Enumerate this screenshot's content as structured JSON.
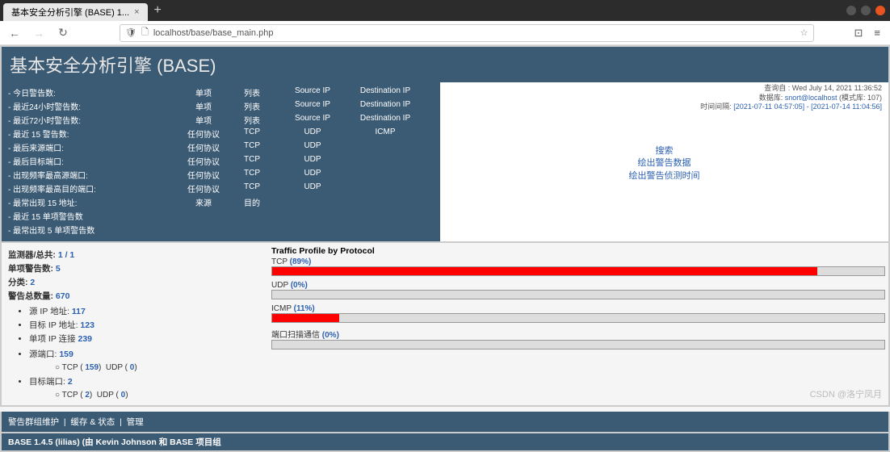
{
  "browser": {
    "tab_title": "基本安全分析引擎 (BASE) 1...",
    "url": "localhost/base/base_main.php"
  },
  "header": {
    "title": "基本安全分析引擎 (BASE)"
  },
  "left": {
    "rows1": [
      {
        "label": "- 今日警告数:",
        "c": [
          "单项",
          "列表",
          "Source IP",
          "Destination IP"
        ]
      },
      {
        "label": "- 最近24小时警告数:",
        "c": [
          "单项",
          "列表",
          "Source IP",
          "Destination IP"
        ]
      },
      {
        "label": "- 最近72小时警告数:",
        "c": [
          "单项",
          "列表",
          "Source IP",
          "Destination IP"
        ]
      },
      {
        "label": "- 最近 15 警告数:",
        "c": [
          "任何协议",
          "TCP",
          "UDP",
          "ICMP"
        ]
      },
      {
        "label": "- 最后来源端口:",
        "c": [
          "任何协议",
          "TCP",
          "UDP",
          ""
        ]
      },
      {
        "label": "- 最后目标端口:",
        "c": [
          "任何协议",
          "TCP",
          "UDP",
          ""
        ]
      },
      {
        "label": "- 出现频率最高源端口:",
        "c": [
          "任何协议",
          "TCP",
          "UDP",
          ""
        ]
      },
      {
        "label": "- 出现频率最高目的端口:",
        "c": [
          "任何协议",
          "TCP",
          "UDP",
          ""
        ]
      },
      {
        "label": "- 最常出现 15 地址:",
        "c": [
          "来源",
          "目的",
          "",
          ""
        ]
      },
      {
        "label": "- 最近 15 单项警告数",
        "c": [
          "",
          "",
          "",
          ""
        ]
      },
      {
        "label": "- 最常出现 5 单项警告数",
        "c": [
          "",
          "",
          "",
          ""
        ]
      }
    ]
  },
  "meta": {
    "queried": "查询自 : Wed July 14, 2021 11:36:52",
    "db_label": "数据库:",
    "db_val": "snort@localhost",
    "db_schema": "(模式库: 107)",
    "time_label": "时间间隔:",
    "time_val": "[2021-07-11 04:57:05] - [2021-07-14 11:04:56]"
  },
  "rlinks": [
    "搜索",
    "绘出警告数据",
    "绘出警告侦测时间"
  ],
  "stats": {
    "l1": {
      "a": "监测器/总共:",
      "b": "1 / 1"
    },
    "l2": {
      "a": "单项警告数:",
      "b": "5"
    },
    "l3": {
      "a": "分类:",
      "b": "2"
    },
    "l4": {
      "a": "警告总数量:",
      "b": "670"
    },
    "li1": {
      "a": "源 IP 地址:",
      "b": "117"
    },
    "li2": {
      "a": "目标 IP 地址:",
      "b": "123"
    },
    "li3": {
      "a": "单项 IP 连接",
      "b": "239"
    },
    "li4": {
      "a": "源端口:",
      "b": "159"
    },
    "sub1": {
      "tcp": "159",
      "udp": "0"
    },
    "li5": {
      "a": "目标端口:",
      "b": "2"
    },
    "sub2": {
      "tcp": "2",
      "udp": "0"
    }
  },
  "chart_data": {
    "type": "bar",
    "title": "Traffic Profile by Protocol",
    "categories": [
      "TCP",
      "UDP",
      "ICMP",
      "端口扫描通信"
    ],
    "values": [
      89,
      0,
      11,
      0
    ],
    "ylim": [
      0,
      100
    ]
  },
  "footer": {
    "f1": [
      "警告群组维护",
      "缓存 & 状态",
      "管理"
    ],
    "f2": "BASE 1.4.5 (lilias) (由 Kevin Johnson 和 BASE 项目组"
  },
  "watermark": "CSDN @洛宁凤月"
}
